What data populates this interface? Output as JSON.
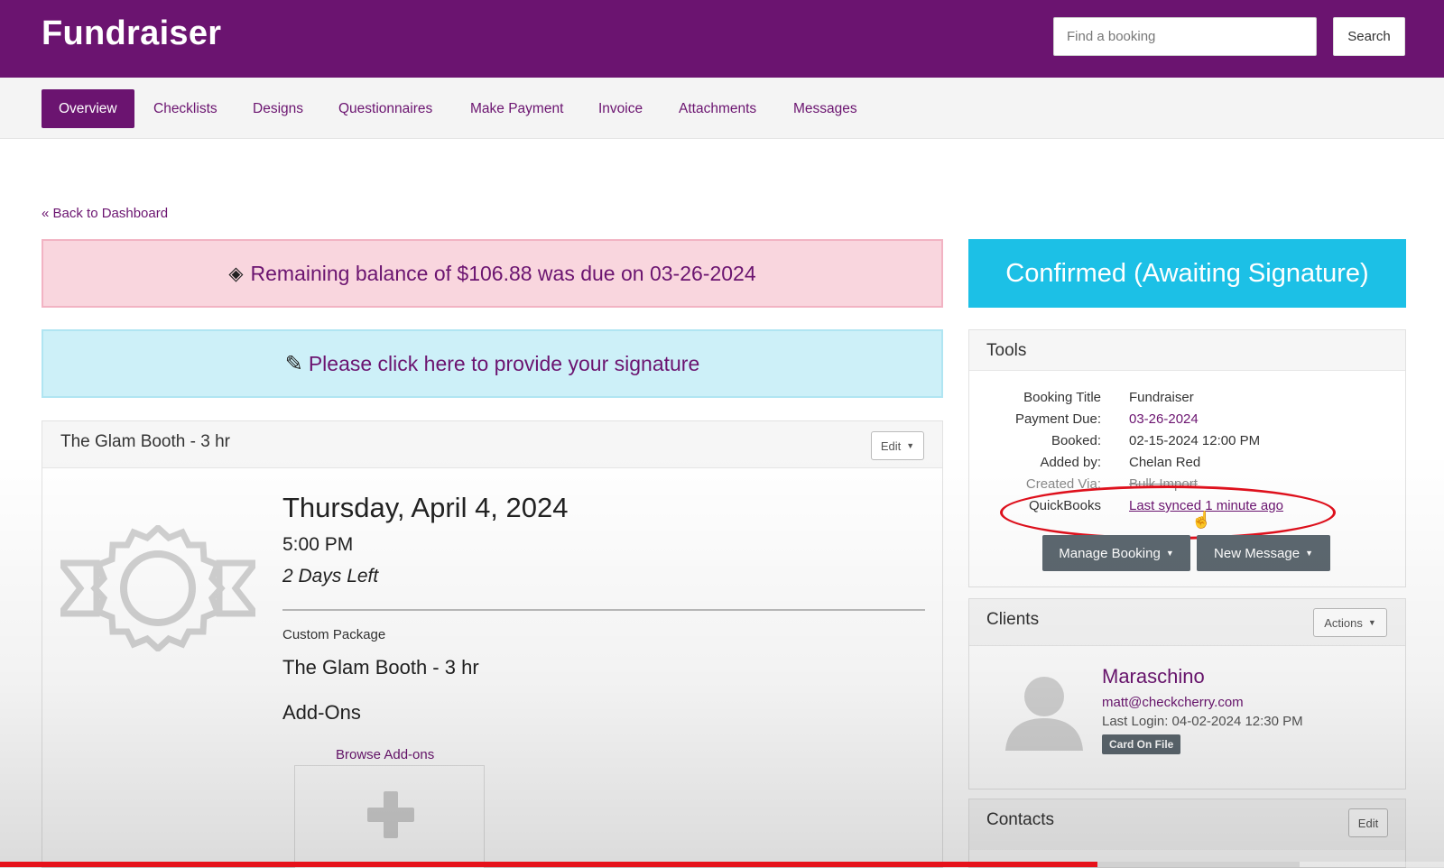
{
  "header": {
    "brand": "Fundraiser",
    "search_placeholder": "Find a booking",
    "search_button": "Search"
  },
  "tabs": [
    {
      "label": "Overview",
      "active": true
    },
    {
      "label": "Checklists"
    },
    {
      "label": "Designs"
    },
    {
      "label": "Questionnaires"
    },
    {
      "label": "Make Payment"
    },
    {
      "label": "Invoice"
    },
    {
      "label": "Attachments"
    },
    {
      "label": "Messages"
    }
  ],
  "back_link": "« Back to Dashboard",
  "alerts": {
    "balance": "Remaining balance of $106.88 was due on 03-26-2024",
    "signature": "Please click here to provide your signature"
  },
  "event": {
    "title": "The Glam Booth - 3 hr",
    "edit_label": "Edit",
    "date": "Thursday, April 4, 2024",
    "time": "5:00 PM",
    "days_left": "2 Days Left",
    "package_label": "Custom Package",
    "package_name": "The Glam Booth - 3 hr",
    "addons_title": "Add-Ons",
    "browse_addons": "Browse Add-ons"
  },
  "status": "Confirmed (Awaiting Signature)",
  "tools": {
    "title": "Tools",
    "rows": [
      {
        "label": "Booking Title",
        "value": "Fundraiser"
      },
      {
        "label": "Payment Due:",
        "value": "03-26-2024"
      },
      {
        "label": "Booked:",
        "value": "02-15-2024 12:00 PM"
      },
      {
        "label": "Added by:",
        "value": "Chelan Red"
      },
      {
        "label": "Created Via:",
        "value": "Bulk Import"
      },
      {
        "label": "QuickBooks",
        "value": "Last synced 1 minute ago"
      }
    ],
    "manage_booking": "Manage Booking",
    "new_message": "New Message"
  },
  "clients": {
    "title": "Clients",
    "actions_label": "Actions",
    "name": "Maraschino",
    "email": "matt@checkcherry.com",
    "last_login": "Last Login: 04-02-2024 12:30 PM",
    "badge": "Card On File"
  },
  "contacts": {
    "title": "Contacts",
    "edit_label": "Edit"
  },
  "icons": {
    "balance": "money-icon",
    "signature": "pencil-icon",
    "caret": "caret-down-icon",
    "cursor": "hand-pointer-icon"
  },
  "colors": {
    "brand_purple": "#6b1470",
    "status_cyan": "#1cc0e6",
    "alert_pink": "#f9d6de",
    "alert_blue": "#cdf0f8",
    "annotation_red": "#e0101c"
  },
  "video_progress": {
    "played": 0.76,
    "buffered_to": 0.9
  }
}
